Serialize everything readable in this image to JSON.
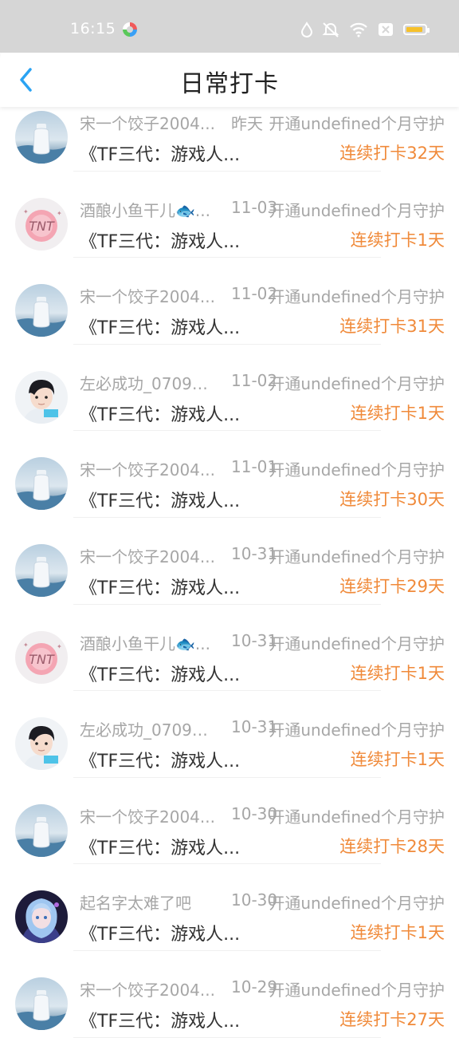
{
  "status": {
    "time": "16:15"
  },
  "header": {
    "title": "日常打卡"
  },
  "colors": {
    "accent": "#f08a3a",
    "back": "#2aa3f3",
    "muted": "#a6a6a6"
  },
  "icons": {
    "back": "chevron-left-icon"
  },
  "items": [
    {
      "user": "宋一个饺子2004...",
      "date": "昨天",
      "action": "开通undefined个月守护",
      "content": "《TF三代：游戏人...",
      "streak": "连续打卡32天",
      "avatar": "bottle"
    },
    {
      "user": "酒酿小鱼干儿🐟...",
      "date": "11-03",
      "action": "开通undefined个月守护",
      "content": "《TF三代：游戏人...",
      "streak": "连续打卡1天",
      "avatar": "tnt"
    },
    {
      "user": "宋一个饺子2004...",
      "date": "11-02",
      "action": "开通undefined个月守护",
      "content": "《TF三代：游戏人...",
      "streak": "连续打卡31天",
      "avatar": "bottle"
    },
    {
      "user": "左必成功_07096...",
      "date": "11-02",
      "action": "开通undefined个月守护",
      "content": "《TF三代：游戏人...",
      "streak": "连续打卡1天",
      "avatar": "boy"
    },
    {
      "user": "宋一个饺子2004...",
      "date": "11-01",
      "action": "开通undefined个月守护",
      "content": "《TF三代：游戏人...",
      "streak": "连续打卡30天",
      "avatar": "bottle"
    },
    {
      "user": "宋一个饺子2004...",
      "date": "10-31",
      "action": "开通undefined个月守护",
      "content": "《TF三代：游戏人...",
      "streak": "连续打卡29天",
      "avatar": "bottle"
    },
    {
      "user": "酒酿小鱼干儿🐟...",
      "date": "10-31",
      "action": "开通undefined个月守护",
      "content": "《TF三代：游戏人...",
      "streak": "连续打卡1天",
      "avatar": "tnt"
    },
    {
      "user": "左必成功_07096...",
      "date": "10-31",
      "action": "开通undefined个月守护",
      "content": "《TF三代：游戏人...",
      "streak": "连续打卡1天",
      "avatar": "boy"
    },
    {
      "user": "宋一个饺子2004...",
      "date": "10-30",
      "action": "开通undefined个月守护",
      "content": "《TF三代：游戏人...",
      "streak": "连续打卡28天",
      "avatar": "bottle"
    },
    {
      "user": "起名字太难了吧",
      "date": "10-30",
      "action": "开通undefined个月守护",
      "content": "《TF三代：游戏人...",
      "streak": "连续打卡1天",
      "avatar": "anime"
    },
    {
      "user": "宋一个饺子2004...",
      "date": "10-29",
      "action": "开通undefined个月守护",
      "content": "《TF三代：游戏人...",
      "streak": "连续打卡27天",
      "avatar": "bottle"
    }
  ]
}
